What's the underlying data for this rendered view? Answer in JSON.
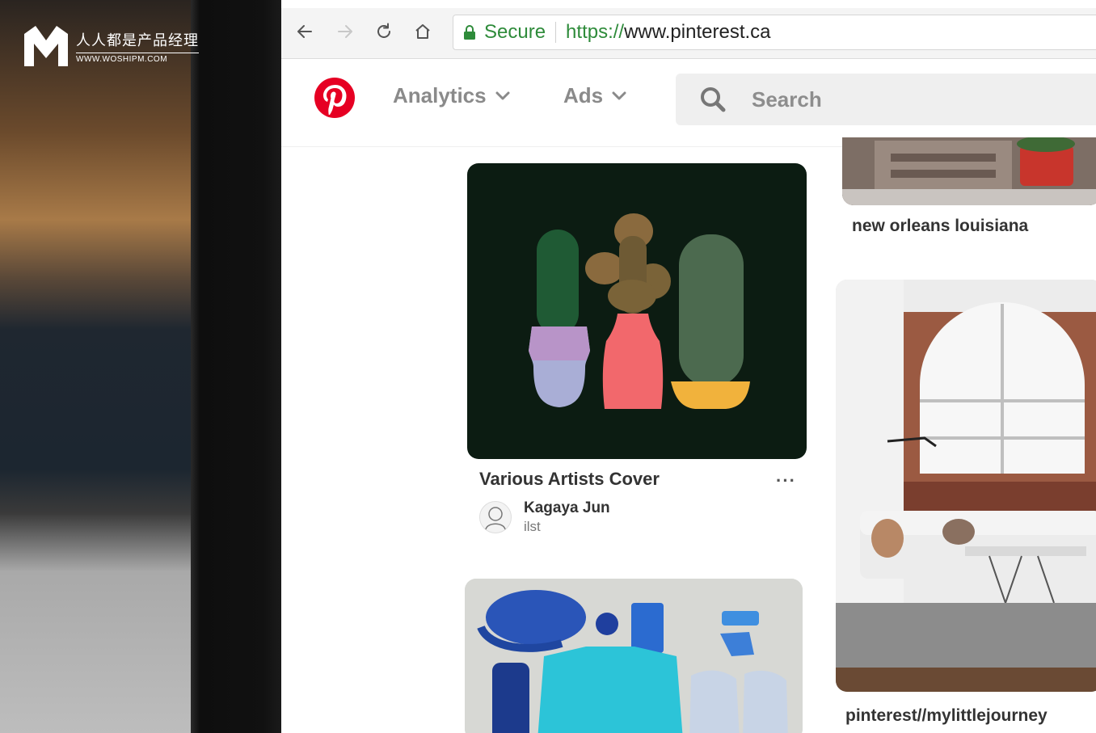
{
  "watermark": {
    "cn": "人人都是产品经理",
    "en": "WWW.WOSHIPM.COM"
  },
  "browser": {
    "secure_label": "Secure",
    "url_scheme": "https://",
    "url_host": "www.pinterest.ca"
  },
  "header": {
    "nav": [
      {
        "label": "Analytics"
      },
      {
        "label": "Ads"
      }
    ],
    "search_placeholder": "Search"
  },
  "pins": [
    {
      "title": "Various Artists Cover",
      "author": "Kagaya Jun",
      "author_sub": "ilst",
      "more": "···"
    },
    {
      "title": "new orleans louisiana"
    },
    {
      "title": "pinterest//mylittlejourney"
    }
  ],
  "colors": {
    "brand": "#E60023",
    "secure": "#2E8B3A"
  }
}
